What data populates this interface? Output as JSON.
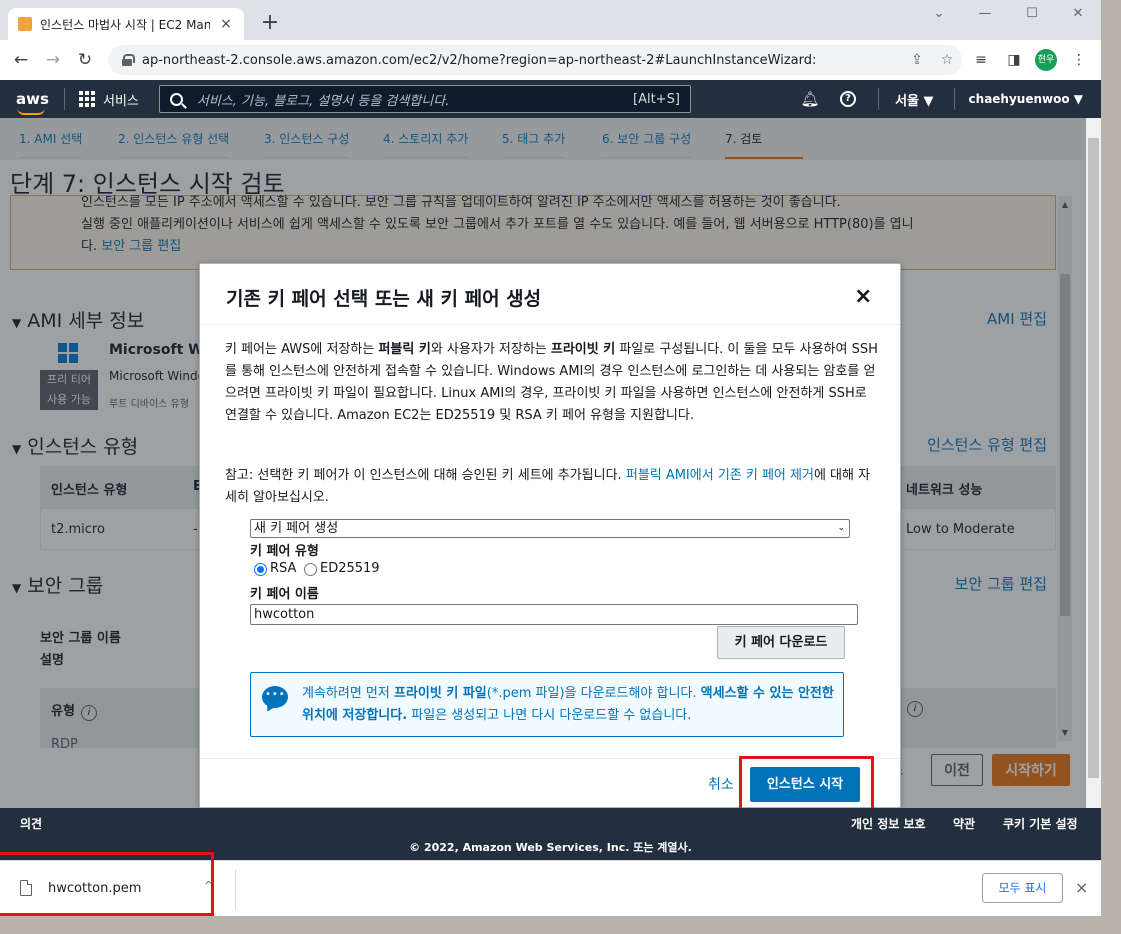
{
  "browser": {
    "tab_title": "인스턴스 마법사 시작 | EC2 Man",
    "tab_close": "×",
    "new_tab": "+",
    "url": "ap-northeast-2.console.aws.amazon.com/ec2/v2/home?region=ap-northeast-2#LaunchInstanceWizard:",
    "profile_initials": "현우"
  },
  "aws_nav": {
    "logo": "aws",
    "services": "서비스",
    "search_placeholder": "서비스, 기능, 블로그, 설명서 등을 검색합니다.",
    "search_shortcut": "[Alt+S]",
    "region": "서울 ▼",
    "user": "chaehyuenwoo ▼"
  },
  "steps": [
    "1. AMI 선택",
    "2. 인스턴스 유형 선택",
    "3. 인스턴스 구성",
    "4. 스토리지 추가",
    "5. 태그 추가",
    "6. 보안 그룹 구성",
    "7. 검토"
  ],
  "page": {
    "title": "단계 7: 인스턴스 시작 검토",
    "warning_line1": "인스턴스를 모든 IP 주소에서 액세스할 수 있습니다. 보안 그룹 규칙을 업데이트하여 알려진 IP 주소에서만 액세스를 허용하는 것이 좋습니다.",
    "warning_line2": "실행 중인 애플리케이션이나 서비스에 쉽게 액세스할 수 있도록 보안 그룹에서 추가 포트를 열 수도 있습니다. 예를 들어, 웹 서버용으로 HTTP(80)를 엽니",
    "warning_line3_prefix": "다.",
    "warning_link": "보안 그룹 편집",
    "ami_section": "AMI 세부 정보",
    "ami_edit": "AMI 편집",
    "ami_name": "Microsoft Wi",
    "ami_desc": "Microsoft Windo",
    "ami_desc2": "루트 디바이스 유형",
    "free_tier_line1": "프리 티어",
    "free_tier_line2": "사용 가능",
    "instance_section": "인스턴스 유형",
    "instance_edit": "인스턴스 유형 편집",
    "instance_table": {
      "col1": "인스턴스 유형",
      "col2": "E",
      "col_last": "네트워크 성능",
      "row_type": "t2.micro",
      "row_col2": "-",
      "row_network": "Low to Moderate"
    },
    "security_section": "보안 그룹",
    "security_edit": "보안 그룹 편집",
    "sg_name_label": "보안 그룹 이름",
    "sg_desc_label": "설명",
    "sg_type_header": "유형",
    "sg_row_partial": "RDP",
    "info_i": "i",
    "bottom_cancel_partial": "소",
    "prev_button": "이전",
    "launch_bottom_button": "시작하기"
  },
  "modal": {
    "title": "기존 키 페어 선택 또는 새 키 페어 생성",
    "close": "×",
    "body_parts": [
      "키 페어는 AWS에 저장하는 ",
      "퍼블릭 키",
      "와 사용자가 저장하는 ",
      "프라이빗 키",
      " 파일로 구성됩니다. 이 둘을 모두 사용하여 SSH를 통해 인스턴스에 안전하게 접속할 수 있습니다. Windows AMI의 경우 인스턴스에 로그인하는 데 사용되는 암호를 얻으려면 프라이빗 키 파일이 필요합니다. Linux AMI의 경우, 프라이빗 키 파일을 사용하면 인스턴스에 안전하게 SSH로 연결할 수 있습니다. Amazon EC2는 ED25519 및 RSA 키 페어 유형을 지원합니다."
    ],
    "note_prefix": "참고: 선택한 키 페어가 이 인스턴스에 대해 승인된 키 세트에 추가됩니다. ",
    "note_link": "퍼블릭 AMI에서 기존 키 페어 제거",
    "note_suffix": "에 대해 자세히 알아보십시오.",
    "select_value": "새 키 페어 생성",
    "select_arrow": "⌄",
    "key_type_label": "키 페어 유형",
    "radio_rsa": "RSA",
    "radio_ed": "ED25519",
    "key_name_label": "키 페어 이름",
    "key_name_value": "hwcotton",
    "download_button": "키 페어 다운로드",
    "info_parts": [
      "계속하려면 먼저 ",
      "프라이빗 키 파일",
      "(*.pem 파일)을 다운로드해야 합니다. ",
      "액세스할 수 있는 안전한 위치에 저장합니다.",
      " 파일은 생성되고 나면 다시 다운로드할 수 없습니다."
    ],
    "cancel": "취소",
    "launch_button": "인스턴스 시작"
  },
  "footer": {
    "feedback": "의견",
    "privacy": "개인 정보 보호",
    "terms": "약관",
    "cookies": "쿠키 기본 설정",
    "copyright": "© 2022, Amazon Web Services, Inc. 또는 계열사."
  },
  "downloads": {
    "file_name": "hwcotton.pem",
    "chevron": "^",
    "show_all": "모두 표시",
    "close": "×"
  },
  "colors": {
    "aws_dark": "#232f3e",
    "aws_orange": "#ff9900",
    "link_blue": "#0073bb",
    "highlight_red": "#e8101b"
  }
}
